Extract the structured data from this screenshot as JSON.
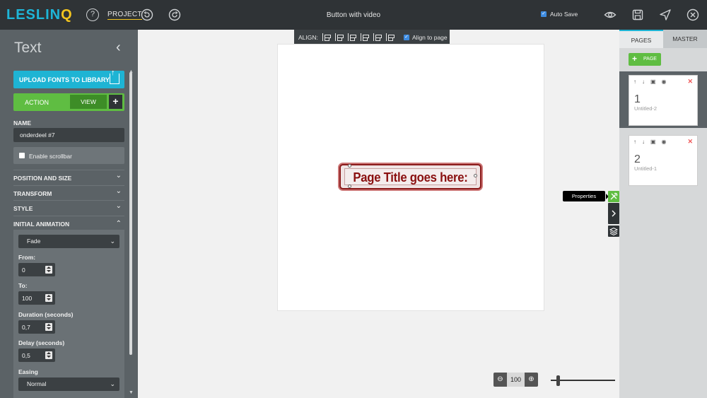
{
  "app": {
    "logo": "LESLINQ",
    "project_label": "PROJECT",
    "document_title": "Button with video",
    "autosave_label": "Auto Save",
    "autosave_checked": true,
    "accent_color": "#1eb4d4",
    "green_color": "#5fbd42"
  },
  "left_panel": {
    "title": "Text",
    "upload_label": "UPLOAD FONTS TO LIBRARY",
    "action_label": "ACTION",
    "view_label": "VIEW",
    "name_label": "NAME",
    "name_value": "onderdeel #7",
    "scrollbar_label": "Enable scrollbar",
    "sections": [
      {
        "label": "POSITION AND SIZE",
        "expanded": false
      },
      {
        "label": "TRANSFORM",
        "expanded": false
      },
      {
        "label": "STYLE",
        "expanded": false
      },
      {
        "label": "INITIAL ANIMATION",
        "expanded": true
      }
    ],
    "animation": {
      "type": "Fade",
      "from_label": "From:",
      "from_value": "0",
      "to_label": "To:",
      "to_value": "100",
      "duration_label": "Duration (seconds)",
      "duration_value": "0,7",
      "delay_label": "Delay (seconds)",
      "delay_value": "0,5",
      "easing_label": "Easing",
      "easing_value": "Normal"
    }
  },
  "canvas": {
    "align_label": "ALIGN:",
    "align_to_page_label": "Align to page",
    "align_to_page_checked": true,
    "element_text": "Page Title goes here:",
    "tooltip": "Properties",
    "zoom_value": "100"
  },
  "right_panel": {
    "tabs": [
      "PAGES",
      "MASTER"
    ],
    "add_page_label": "PAGE",
    "pages": [
      {
        "number": "1",
        "name": "Untitled-2",
        "selected": true
      },
      {
        "number": "2",
        "name": "Untitled-1",
        "selected": false
      }
    ]
  }
}
